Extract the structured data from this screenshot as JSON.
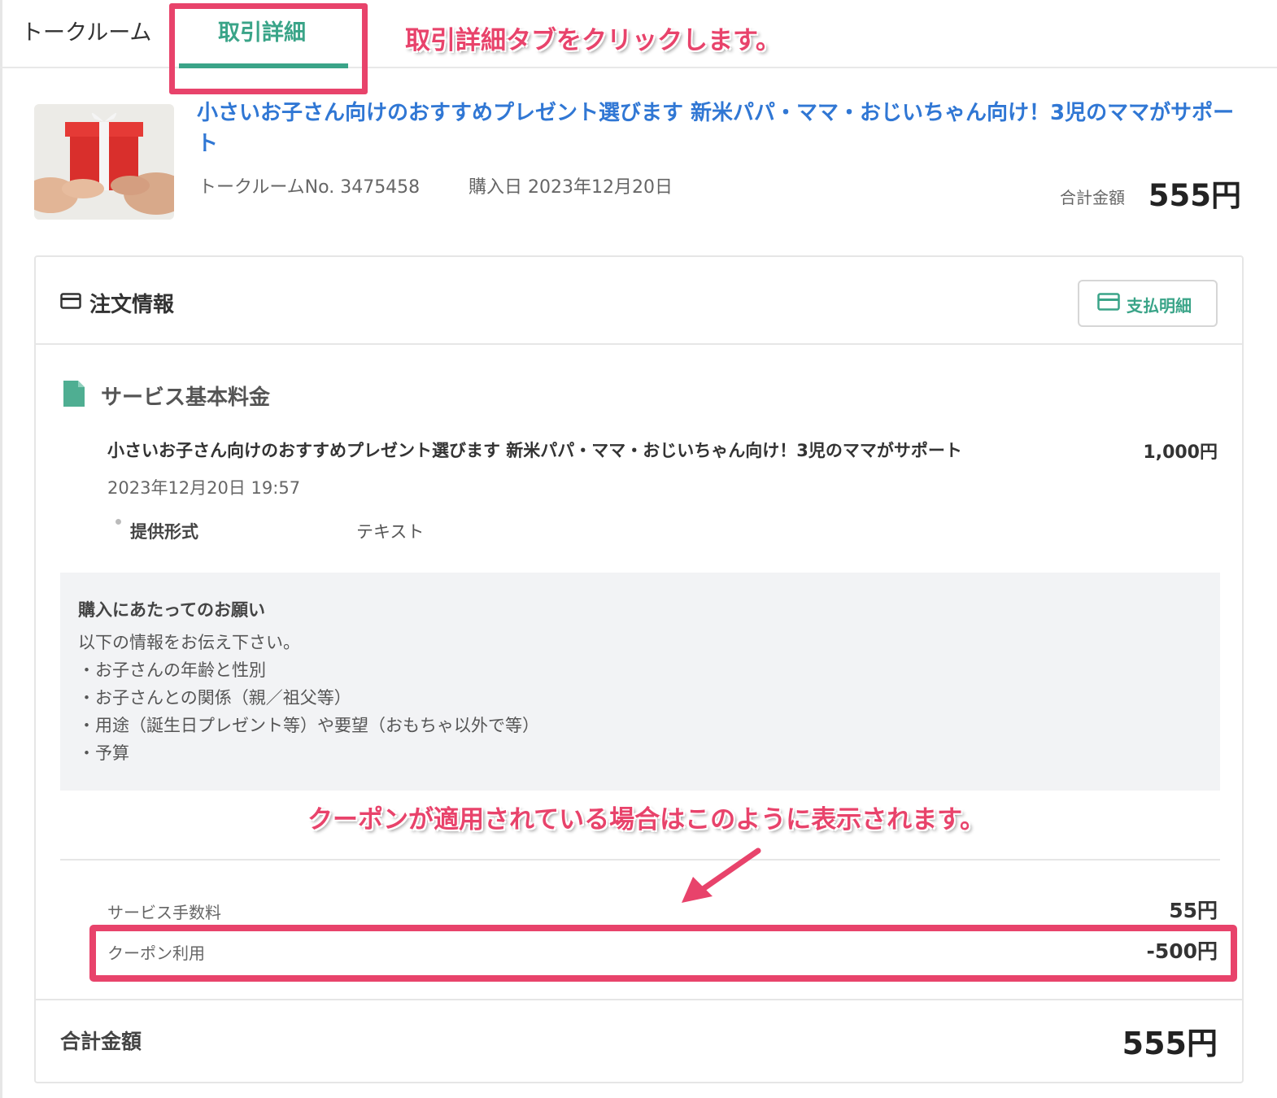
{
  "tabs": [
    {
      "label": "トークルーム",
      "active": false
    },
    {
      "label": "取引詳細",
      "active": true
    }
  ],
  "annotations": {
    "tab_hint": "取引詳細タブをクリックします。",
    "coupon_hint": "クーポンが適用されている場合はこのように表示されます。"
  },
  "product": {
    "title": "小さいお子さん向けのおすすめプレゼント選びます 新米パパ・ママ・おじいちゃん向け！3児のママがサポート",
    "talkroom_no": "トークルームNo. 3475458",
    "purchase_date": "購入日 2023年12月20日",
    "total_label": "合計金額",
    "total_value": "555円",
    "thumbnail": "gift-box-photo"
  },
  "order": {
    "title": "注文情報",
    "pay_button": "支払明細",
    "section_title": "サービス基本料金",
    "item_name": "小さいお子さん向けのおすすめプレゼント選びます 新米パパ・ママ・おじいちゃん向け！3児のママがサポート",
    "item_price": "1,000円",
    "item_datetime": "2023年12月20日 19:57",
    "spec_label": "提供形式",
    "spec_value": "テキスト",
    "note": {
      "title": "購入にあたってのお願い",
      "lines": [
        "以下の情報をお伝え下さい。",
        "・お子さんの年齢と性別",
        "・お子さんとの関係（親／祖父等）",
        "・用途（誕生日プレゼント等）や要望（おもちゃ以外で等）",
        "・予算"
      ]
    },
    "service_fee_label": "サービス手数料",
    "service_fee_value": "55円",
    "coupon_label": "クーポン利用",
    "coupon_value": "-500円",
    "total_label": "合計金額",
    "total_value": "555円"
  },
  "colors": {
    "accent_green": "#3aa488",
    "link_blue": "#3077d4",
    "highlight_pink": "#e8436b"
  }
}
